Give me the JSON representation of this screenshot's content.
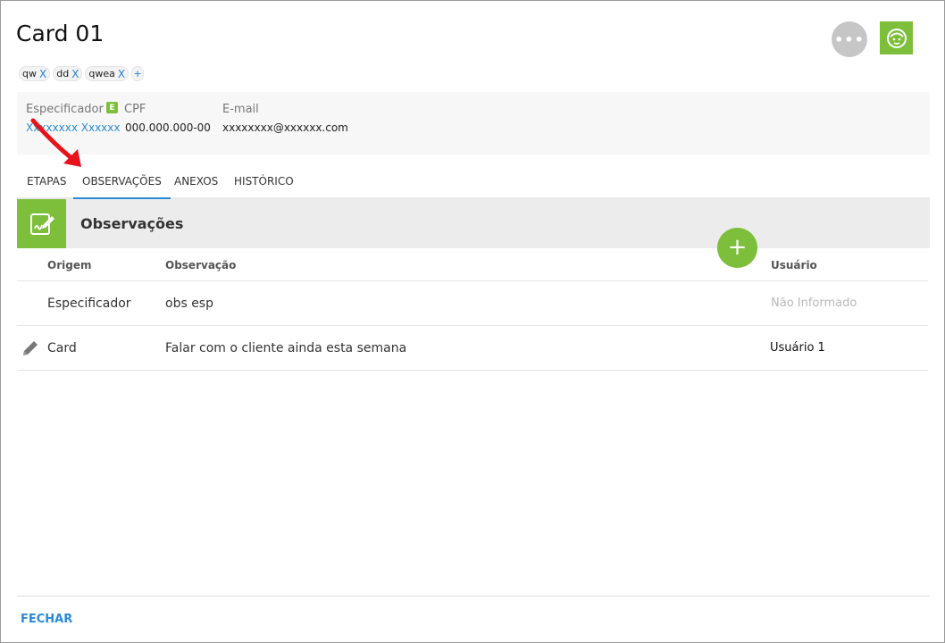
{
  "card": {
    "title": "Card 01"
  },
  "header": {
    "more_icon": "more-horizontal-icon",
    "more_label": "•••",
    "user_icon": "user-face-icon"
  },
  "tags": [
    {
      "label": "qw",
      "remove": "X"
    },
    {
      "label": "dd",
      "remove": "X"
    },
    {
      "label": "qwea",
      "remove": "X"
    }
  ],
  "tags_add": "+",
  "info": {
    "especificador_label": "Especificador",
    "especificador_value": "Xxxxxxxx Xxxxxx",
    "badge": "E",
    "cpf_label": "CPF",
    "cpf_value": "000.000.000-00",
    "email_label": "E-mail",
    "email_value": "xxxxxxxx@xxxxxx.com"
  },
  "tabs": [
    {
      "label": "ETAPAS"
    },
    {
      "label": "OBSERVAÇÕES",
      "active": true
    },
    {
      "label": "ANEXOS"
    },
    {
      "label": "HISTÓRICO"
    }
  ],
  "section": {
    "title": "Observações",
    "icon": "note-edit-icon"
  },
  "add_button": "+",
  "table": {
    "columns": {
      "origem": "Origem",
      "observacao": "Observação",
      "usuario": "Usuário"
    },
    "rows": [
      {
        "origem": "Especificador",
        "observacao": "obs esp",
        "usuario": "Não Informado",
        "editable": false
      },
      {
        "origem": "Card",
        "observacao": "Falar com o cliente ainda esta semana",
        "usuario": "Usuário 1",
        "editable": true
      }
    ]
  },
  "footer": {
    "close": "FECHAR"
  },
  "colors": {
    "accent_green": "#7dbf3b",
    "link_blue": "#2a8ad6",
    "annotation_red": "#e8121b"
  }
}
